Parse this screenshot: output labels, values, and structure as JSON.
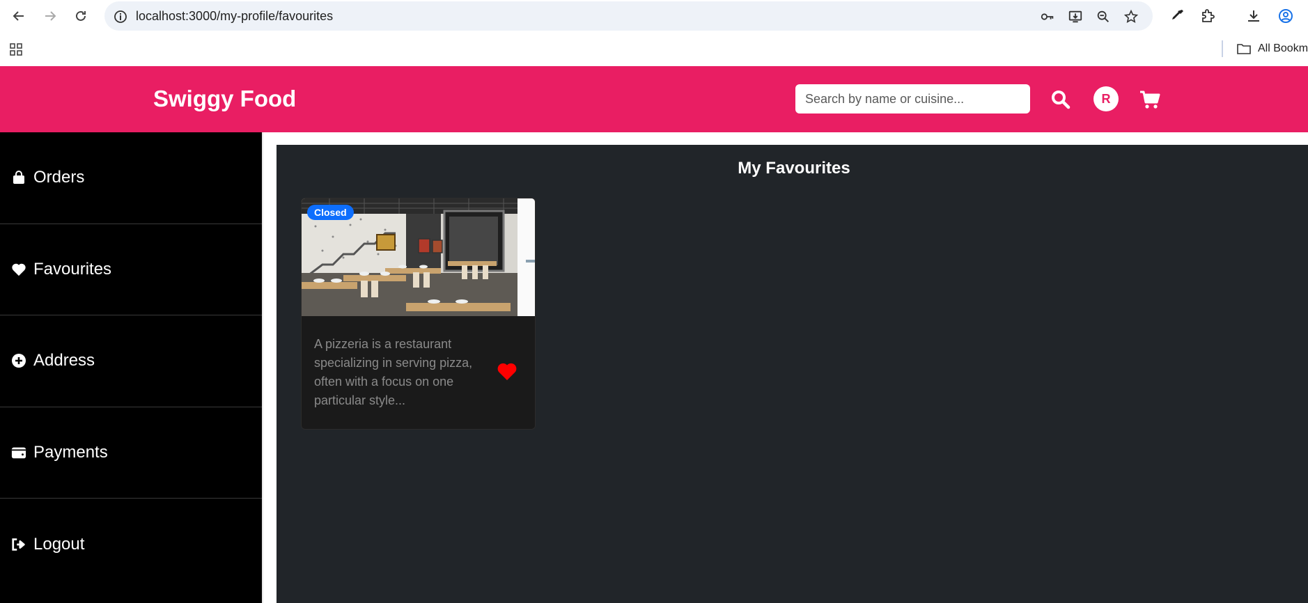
{
  "browser": {
    "url": "localhost:3000/my-profile/favourites",
    "bookmarks_label": "All Bookmarks"
  },
  "header": {
    "brand": "Swiggy Food",
    "search_placeholder": "Search by name or cuisine...",
    "avatar_initial": "R",
    "accent_color": "#e91e63"
  },
  "sidebar": {
    "items": [
      {
        "label": "Orders",
        "icon": "shopping-bag-icon"
      },
      {
        "label": "Favourites",
        "icon": "heart-icon"
      },
      {
        "label": "Address",
        "icon": "plus-circle-icon"
      },
      {
        "label": "Payments",
        "icon": "wallet-icon"
      },
      {
        "label": "Logout",
        "icon": "logout-icon"
      }
    ]
  },
  "main": {
    "title": "My Favourites",
    "cards": [
      {
        "status": "Closed",
        "description": "A pizzeria is a restaurant specializing in serving pizza, often with a focus on one particular style...",
        "favourited": true
      }
    ]
  }
}
